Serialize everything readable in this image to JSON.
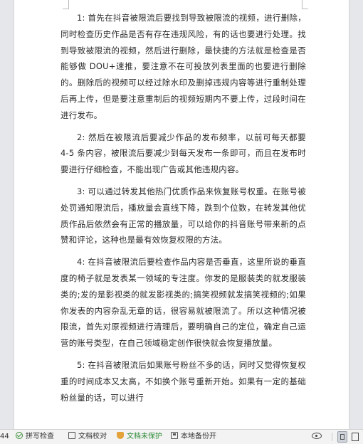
{
  "document": {
    "paragraphs": [
      "1: 首先在抖音被限流后要找到导致被限流的视频，进行删除，同时检查历史作品是否有存在违规风险，有的话也要进行处理。找到导致被限流的视频，然后进行删除，最快捷的方法就是检查是否能够做 DOU+速推，要注意不在可投放列表里面的也要进行删除的。删除后的视频可以经过除水印及删掉违规内容等进行重制处理后再上传，但是要注意重制后的视频短期内不要上传，过段时间在进行发布。",
      "2: 然后在被限流后要减少作品的发布频率，以前可每天都要 4-5 条内容，被限流后要减少到每天发布一条即可，而且在发布时要进行仔细检查，不能出现广告或其他违规内容。",
      "3: 可以通过转发其他热门优质作品来恢复账号权重。在账号被处罚通知限流后，播放量会直线下降，跌到个位数，在转发其他优质作品后依然会有正常的播放量，可以给你的抖音账号带来新的点赞和评论，这种也是最有效恢复权限的方法。",
      "4: 在抖音被限流后要检查作品内容是否垂直，这里所说的垂直度的椅子就是发表某一领域的专注度。你发的是服装类的就发服装类的;发的是影视类的就发影视类的;搞笑视频就发搞笑视频的;如果你发表的内容杂乱无章的话，很容易就被限流了。所以这种情况被限流，首先对原视频进行清理后，要明确自己的定位，确定自己运营的账号类型，在自己领域稳定创作很快就会恢复播放量。",
      "5: 在抖音被限流后如果账号粉丝不多的话，同时又觉得恢复权重的时间成本又太高，不如换个账号重新开始。如果有一定的基础粉丝量的话，可以进行"
    ]
  },
  "statusbar": {
    "page_fragment": "44",
    "spell_check": "拼写检查",
    "doc_proofread": "文档校对",
    "doc_unprotected": "文档未保护",
    "local_backup": "本地备份开"
  },
  "colors": {
    "green": "#2f8a36",
    "shield": "#e3a23a"
  }
}
